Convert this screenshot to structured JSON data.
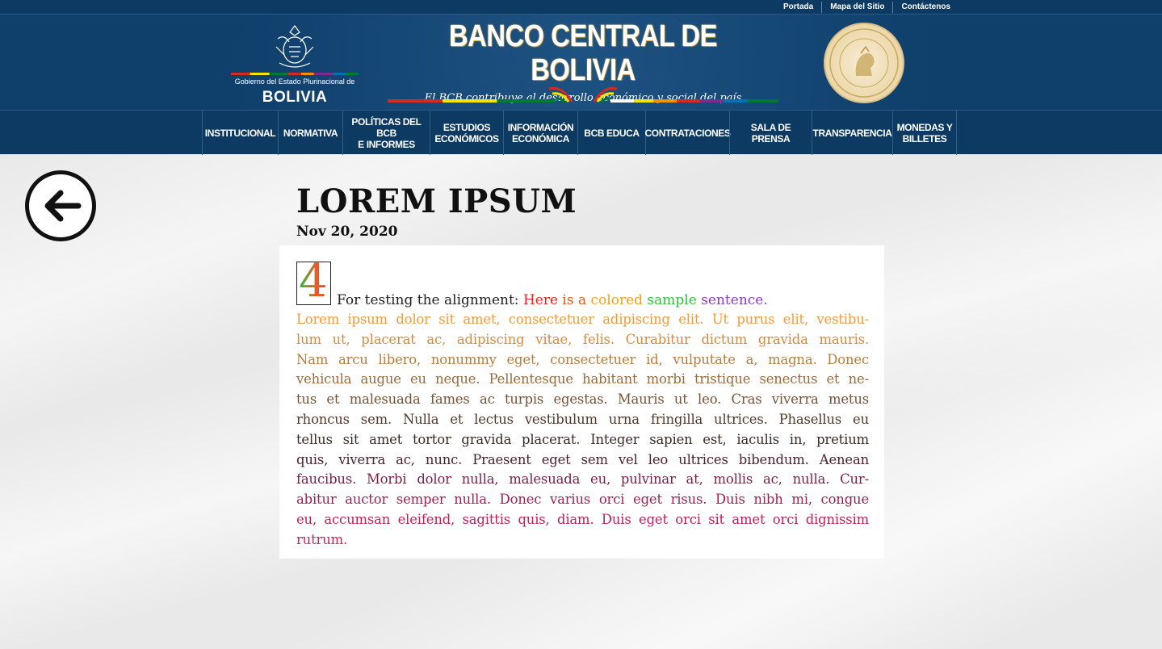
{
  "toplinks": {
    "home": "Portada",
    "sitemap": "Mapa del Sitio",
    "contact": "Contáctenos"
  },
  "header": {
    "gov_text": "Gobierno del Estado Plurinacional de",
    "gov_country": "BOLIVIA",
    "bank_title": "BANCO CENTRAL DE BOLIVIA",
    "slogan": "El BCB contribuye al desarrollo económico y social del país"
  },
  "nav": [
    {
      "label": "INSTITUCIONAL"
    },
    {
      "label": "NORMATIVA"
    },
    {
      "label": "POLÍTICAS DEL BCB\nE INFORMES"
    },
    {
      "label": "ESTUDIOS\nECONÓMICOS"
    },
    {
      "label": "INFORMACIÓN\nECONÓMICA"
    },
    {
      "label": "BCB EDUCA"
    },
    {
      "label": "CONTRATACIONES"
    },
    {
      "label": "SALA DE PRENSA"
    },
    {
      "label": "TRANSPARENCIA"
    },
    {
      "label": "MONEDAS Y\nBILLETES"
    }
  ],
  "article": {
    "title": "LOREM IPSUM",
    "date": "Nov 20, 2020",
    "digit": "4",
    "first_line": {
      "prefix": "For testing the alignment: ",
      "words": [
        {
          "text": "Here",
          "color": "#e8231b"
        },
        {
          "text": " is a ",
          "color": "#e8561b"
        },
        {
          "text": "colored",
          "color": "#f0a01e"
        },
        {
          "text": " sample ",
          "color": "#2ec23c"
        },
        {
          "text": "sentence.",
          "color": "#8a3cc0"
        }
      ]
    },
    "lines": [
      {
        "text": "Lorem ipsum dolor sit amet, consectetuer adipiscing elit. Ut purus elit, vestibu-",
        "color": "#f39a3a"
      },
      {
        "text": "lum ut, placerat ac, adipiscing vitae, felis. Curabitur dictum gravida mauris.",
        "color": "#d98a3a"
      },
      {
        "text": "Nam arcu libero, nonummy eget, consectetuer id, vulputate a, magna. Donec",
        "color": "#b97c3c"
      },
      {
        "text": "vehicula augue eu neque. Pellentesque habitant morbi tristique senectus et ne-",
        "color": "#9a6a3a"
      },
      {
        "text": "tus et malesuada fames ac turpis egestas. Mauris ut leo. Cras viverra metus",
        "color": "#7a5233"
      },
      {
        "text": "rhoncus sem. Nulla et lectus vestibulum urna fringilla ultrices. Phasellus eu",
        "color": "#54392a"
      },
      {
        "text": "tellus sit amet tortor gravida placerat. Integer sapien est, iaculis in, pretium",
        "color": "#3d2a24"
      },
      {
        "text": "quis, viverra ac, nunc. Praesent eget sem vel leo ultrices bibendum. Aenean",
        "color": "#4a2030"
      },
      {
        "text": "faucibus. Morbi dolor nulla, malesuada eu, pulvinar at, mollis ac, nulla. Cur-",
        "color": "#7a1f44"
      },
      {
        "text": "abitur auctor semper nulla. Donec varius orci eget risus. Duis nibh mi, congue",
        "color": "#a2204f"
      },
      {
        "text": "eu, accumsan eleifend, sagittis quis, diam. Duis eget orci sit amet orci dignissim",
        "color": "#c02257"
      },
      {
        "text": "rutrum.",
        "color": "#c8245a"
      }
    ]
  },
  "colors": {
    "header_bg": "#0f3f6b",
    "nav_bg": "#0c3a63"
  }
}
